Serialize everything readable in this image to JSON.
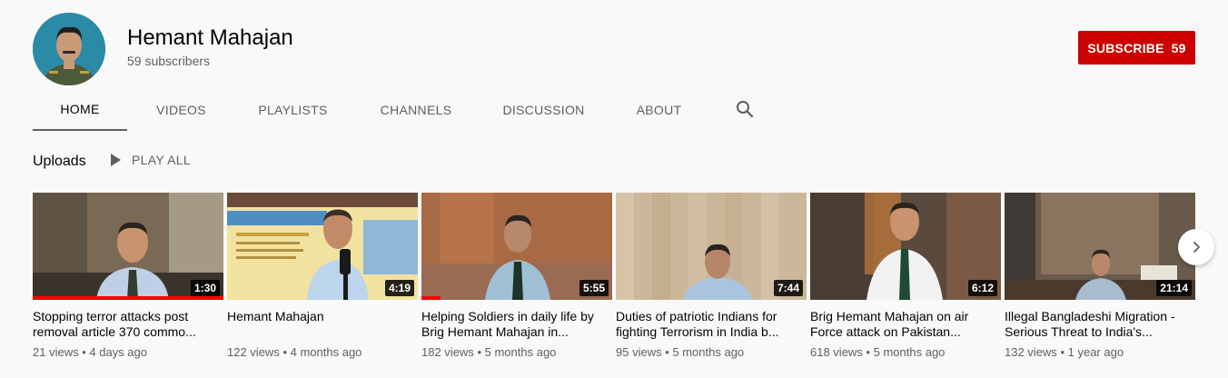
{
  "channel": {
    "name": "Hemant Mahajan",
    "subscribers": "59 subscribers",
    "avatar_icon": "person-avatar"
  },
  "subscribe": {
    "label": "SUBSCRIBE",
    "count": "59",
    "color": "#cc0000"
  },
  "tabs": [
    {
      "label": "HOME",
      "active": true
    },
    {
      "label": "VIDEOS"
    },
    {
      "label": "PLAYLISTS"
    },
    {
      "label": "CHANNELS"
    },
    {
      "label": "DISCUSSION"
    },
    {
      "label": "ABOUT"
    }
  ],
  "search_icon": "search-icon",
  "section": {
    "title": "Uploads",
    "play_all": "PLAY ALL"
  },
  "videos": [
    {
      "title": "Stopping terror attacks post removal article 370 commo...",
      "views": "21 views",
      "age": "4 days ago",
      "duration": "1:30",
      "watched": 1.0
    },
    {
      "title": "Hemant Mahajan",
      "views": "122 views",
      "age": "4 months ago",
      "duration": "4:19",
      "watched": 0
    },
    {
      "title": "Helping Soldiers in daily life by Brig Hemant Mahajan in...",
      "views": "182 views",
      "age": "5 months ago",
      "duration": "5:55",
      "watched": 0.1
    },
    {
      "title": "Duties of patriotic Indians for fighting Terrorism in India b...",
      "views": "95 views",
      "age": "5 months ago",
      "duration": "7:44",
      "watched": 0
    },
    {
      "title": "Brig Hemant Mahajan on air Force attack on Pakistan...",
      "views": "618 views",
      "age": "5 months ago",
      "duration": "6:12",
      "watched": 0
    },
    {
      "title": "Illegal Bangladeshi Migration - Serious Threat to India's...",
      "views": "132 views",
      "age": "1 year ago",
      "duration": "21:14",
      "watched": 0
    }
  ],
  "separator": "•"
}
